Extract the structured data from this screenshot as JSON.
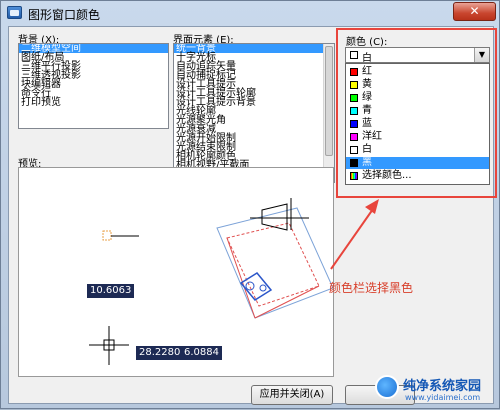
{
  "window": {
    "title": "图形窗口颜色",
    "close_glyph": "✕"
  },
  "context": {
    "label": "背景 (X):",
    "items": [
      "二维模型空间",
      "图纸/布局",
      "三维平行投影",
      "三维透视投影",
      "块编辑器",
      "命令行",
      "打印预览"
    ],
    "selected_index": 0
  },
  "interface_element": {
    "label": "界面元素 (E):",
    "items": [
      "统一背景",
      "十字光标",
      "自动追踪矢量",
      "自动捕捉标记",
      "设计工具提示",
      "设计工具提示轮廓",
      "设计工具提示背景",
      "光线轮廓",
      "光源聚光角",
      "光源衰减",
      "光源开始限制",
      "光源结束限制",
      "相机轮廓颜色",
      "相机视野/平截面"
    ],
    "selected_index": 0
  },
  "color": {
    "label": "颜色 (C):",
    "selected": {
      "name": "白",
      "swatch": "#ffffff"
    },
    "options": [
      {
        "name": "红",
        "swatch": "#ff0000"
      },
      {
        "name": "黄",
        "swatch": "#ffff00"
      },
      {
        "name": "绿",
        "swatch": "#00ff00"
      },
      {
        "name": "青",
        "swatch": "#00ffff"
      },
      {
        "name": "蓝",
        "swatch": "#0000ff"
      },
      {
        "name": "洋红",
        "swatch": "#ff00ff"
      },
      {
        "name": "白",
        "swatch": "#ffffff"
      },
      {
        "name": "黑",
        "swatch": "#000000"
      },
      {
        "name": "选择颜色...",
        "swatch": "multicolor-icon"
      }
    ],
    "highlighted_index": 7
  },
  "preview": {
    "label": "预览:",
    "dim_value_1": "10.6063",
    "dim_value_2": "28.2280",
    "dim_value_3": "6.0884"
  },
  "buttons": {
    "apply_close": "应用并关闭(A)"
  },
  "annotation": {
    "text": "颜色栏选择黑色",
    "color": "#d8402c"
  },
  "watermark": {
    "name": "纯净系统家园",
    "url": "www.yidaimei.com"
  }
}
